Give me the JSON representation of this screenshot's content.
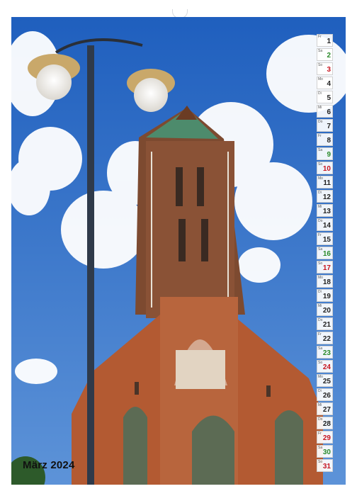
{
  "calendar": {
    "month_label": "März 2024",
    "days": [
      {
        "wd": "Fr",
        "d": "1",
        "t": "work"
      },
      {
        "wd": "Sa",
        "d": "2",
        "t": "sat"
      },
      {
        "wd": "So",
        "d": "3",
        "t": "sun"
      },
      {
        "wd": "Mo",
        "d": "4",
        "t": "work"
      },
      {
        "wd": "Di",
        "d": "5",
        "t": "work"
      },
      {
        "wd": "Mi",
        "d": "6",
        "t": "work"
      },
      {
        "wd": "Do",
        "d": "7",
        "t": "work"
      },
      {
        "wd": "Fr",
        "d": "8",
        "t": "work"
      },
      {
        "wd": "Sa",
        "d": "9",
        "t": "sat"
      },
      {
        "wd": "So",
        "d": "10",
        "t": "sun"
      },
      {
        "wd": "Mo",
        "d": "11",
        "t": "work"
      },
      {
        "wd": "Di",
        "d": "12",
        "t": "work"
      },
      {
        "wd": "Mi",
        "d": "13",
        "t": "work"
      },
      {
        "wd": "Do",
        "d": "14",
        "t": "work"
      },
      {
        "wd": "Fr",
        "d": "15",
        "t": "work"
      },
      {
        "wd": "Sa",
        "d": "16",
        "t": "sat"
      },
      {
        "wd": "So",
        "d": "17",
        "t": "sun"
      },
      {
        "wd": "Mo",
        "d": "18",
        "t": "work"
      },
      {
        "wd": "Di",
        "d": "19",
        "t": "work"
      },
      {
        "wd": "Mi",
        "d": "20",
        "t": "work"
      },
      {
        "wd": "Do",
        "d": "21",
        "t": "work"
      },
      {
        "wd": "Fr",
        "d": "22",
        "t": "work"
      },
      {
        "wd": "Sa",
        "d": "23",
        "t": "sat"
      },
      {
        "wd": "So",
        "d": "24",
        "t": "sun"
      },
      {
        "wd": "Mo",
        "d": "25",
        "t": "work"
      },
      {
        "wd": "Di",
        "d": "26",
        "t": "work"
      },
      {
        "wd": "Mi",
        "d": "27",
        "t": "work"
      },
      {
        "wd": "Do",
        "d": "28",
        "t": "work"
      },
      {
        "wd": "Fr",
        "d": "29",
        "t": "sun"
      },
      {
        "wd": "Sa",
        "d": "30",
        "t": "sat"
      },
      {
        "wd": "So",
        "d": "31",
        "t": "sun"
      }
    ]
  },
  "colors": {
    "sky": "#2f6fc4",
    "brick": "#a8552f",
    "sunday": "#c8141e",
    "saturday": "#2a8a2a"
  }
}
